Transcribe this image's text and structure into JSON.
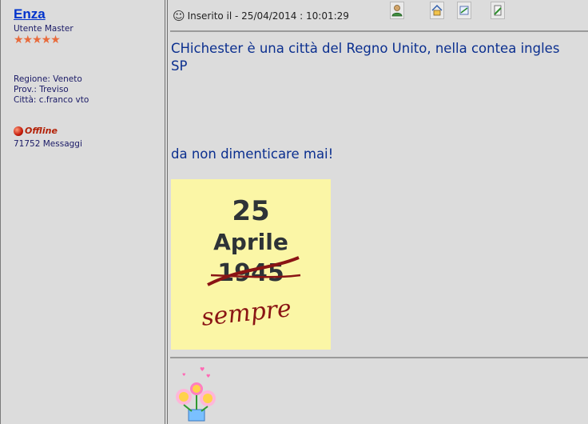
{
  "user": {
    "name": "Enza",
    "role": "Utente Master",
    "stars": "★★★★★",
    "region": "Regione: Veneto",
    "province": "Prov.: Treviso",
    "city": "Città: c.franco vto",
    "status": "Offline",
    "messages": "71752 Messaggi"
  },
  "post": {
    "posted_label": "Inserito il - 25/04/2014 : 10:01:29",
    "line1": "CHichester è una città del Regno Unito, nella contea ingles",
    "line2": "SP",
    "line3": "da non dimenticare mai!",
    "poster": {
      "number": "25",
      "word": "Aprile",
      "year": "1945",
      "sempre": "sempre"
    }
  },
  "icons": {
    "status": "offline-dot-icon",
    "profile": "user-profile-icon",
    "home": "home-icon",
    "reply": "reply-quote-icon",
    "edit": "edit-icon"
  },
  "colors": {
    "background": "#dcdcdc",
    "link": "#0033cc",
    "text": "#0b2f8f",
    "offline": "#b32208",
    "poster_bg": "#fbf6a6",
    "sempre": "#8a1414"
  }
}
